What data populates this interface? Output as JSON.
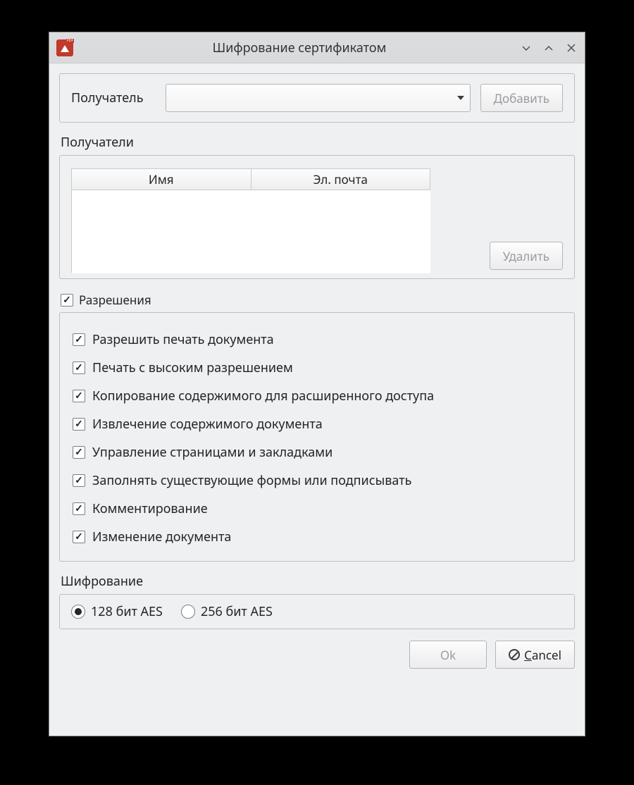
{
  "window": {
    "title": "Шифрование сертификатом"
  },
  "recipient": {
    "label": "Получатель",
    "selected": "",
    "add_button": "Добавить"
  },
  "recipients_section": {
    "label": "Получатели",
    "columns": {
      "name": "Имя",
      "email": "Эл. почта"
    },
    "rows": [],
    "delete_button": "Удалить"
  },
  "permissions": {
    "master_label": "Разрешения",
    "master_checked": true,
    "items": [
      {
        "label": "Разрешить печать документа",
        "checked": true
      },
      {
        "label": "Печать с высоким разрешением",
        "checked": true
      },
      {
        "label": "Копирование содержимого для расширенного доступа",
        "checked": true
      },
      {
        "label": "Извлечение содержимого документа",
        "checked": true
      },
      {
        "label": "Управление страницами и закладками",
        "checked": true
      },
      {
        "label": "Заполнять существующие формы или подписывать",
        "checked": true
      },
      {
        "label": "Комментирование",
        "checked": true
      },
      {
        "label": "Изменение документа",
        "checked": true
      }
    ]
  },
  "encryption": {
    "label": "Шифрование",
    "options": [
      {
        "label": "128 бит AES",
        "selected": true
      },
      {
        "label": "256 бит AES",
        "selected": false
      }
    ]
  },
  "buttons": {
    "ok": "Ok",
    "cancel": "Cancel",
    "cancel_accel": "C"
  }
}
